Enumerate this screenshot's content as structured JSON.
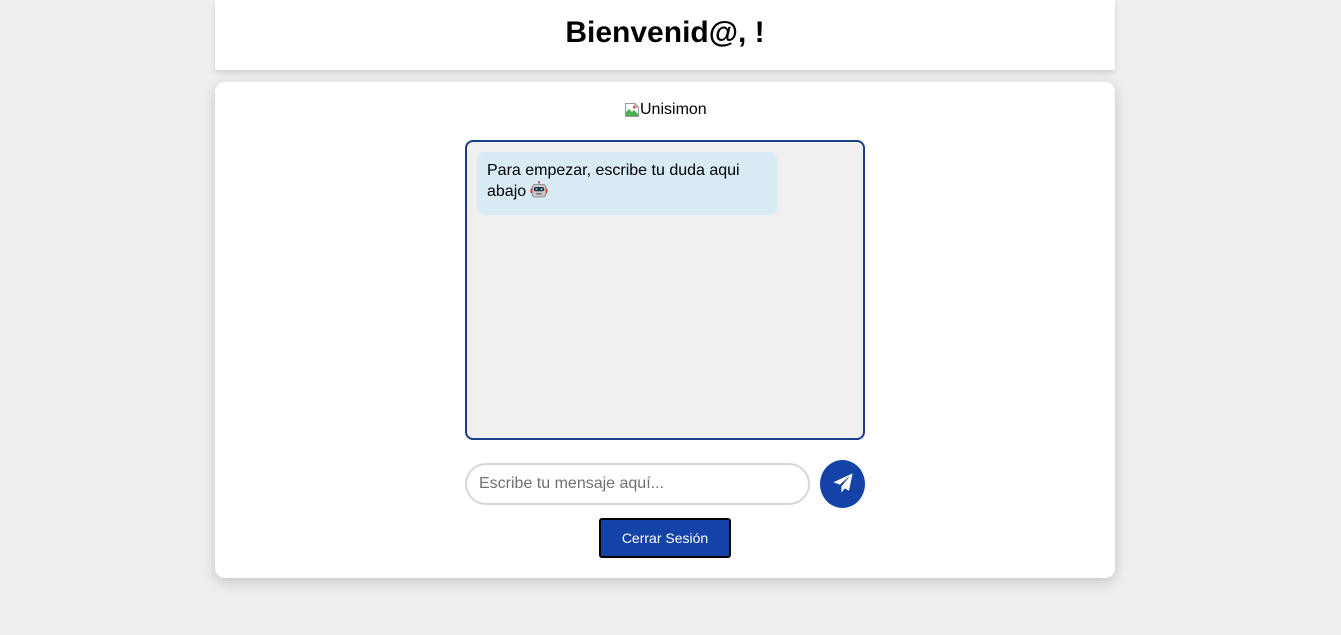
{
  "header": {
    "title": "Bienvenid@, !"
  },
  "logo": {
    "alt_text": "Unisimon"
  },
  "chat": {
    "messages": [
      {
        "text": "Para empezar, escribe tu duda aqui abajo",
        "icon": "robot-icon"
      }
    ]
  },
  "input": {
    "value": "",
    "placeholder": "Escribe tu mensaje aquí..."
  },
  "send_button": {
    "icon": "paper-plane-icon",
    "color": "#1443a8"
  },
  "logout_button": {
    "label": "Cerrar Sesión"
  },
  "colors": {
    "accent": "#1443a8",
    "chat_border": "#1a3f8a",
    "bubble_bg": "#d9ebf5",
    "page_bg": "#efefef"
  }
}
